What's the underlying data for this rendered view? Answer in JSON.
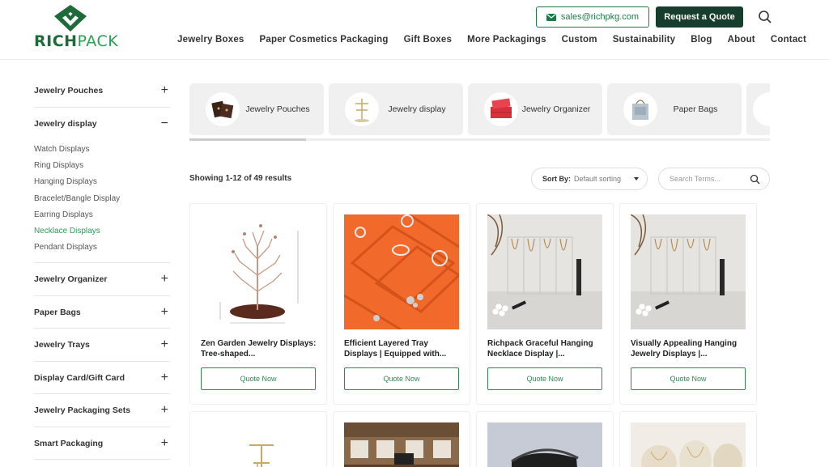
{
  "header": {
    "logo_text_bold": "RICH",
    "logo_text_light": "PACK",
    "email": "sales@richpkg.com",
    "quote_button": "Request a Quote",
    "nav": [
      "Jewelry Boxes",
      "Paper Cosmetics Packaging",
      "Gift Boxes",
      "More Packagings",
      "Custom",
      "Sustainability",
      "Blog",
      "About",
      "Contact"
    ]
  },
  "sidebar": {
    "categories": [
      {
        "label": "Jewelry Pouches",
        "sign": "+"
      },
      {
        "label": "Jewelry display",
        "sign": "−",
        "open": true,
        "subs": [
          "Watch Displays",
          "Ring Displays",
          "Hanging Displays",
          "Bracelet/Bangle Display",
          "Earring Displays",
          "Necklace Displays",
          "Pendant Displays"
        ],
        "active_sub": "Necklace Displays"
      },
      {
        "label": "Jewelry Organizer",
        "sign": "+"
      },
      {
        "label": "Paper Bags",
        "sign": "+"
      },
      {
        "label": "Jewelry Trays",
        "sign": "+"
      },
      {
        "label": "Display Card/Gift Card",
        "sign": "+"
      },
      {
        "label": "Jewelry Packaging Sets",
        "sign": "+"
      },
      {
        "label": "Smart Packaging",
        "sign": "+"
      }
    ]
  },
  "carousel": [
    "Jewelry Pouches",
    "Jewelry display",
    "Jewelry Organizer",
    "Paper Bags"
  ],
  "toolbar": {
    "results": "Showing 1-12 of 49 results",
    "sort_label": "Sort By:",
    "sort_value": "Default sorting",
    "search_placeholder": "Search Terms..."
  },
  "products": [
    {
      "title": "Zen Garden Jewelry Displays: Tree-shaped...",
      "button": "Quote Now"
    },
    {
      "title": "Efficient Layered Tray Displays | Equipped with...",
      "button": "Quote Now"
    },
    {
      "title": "Richpack Graceful Hanging Necklace Display |...",
      "button": "Quote Now"
    },
    {
      "title": "Visually Appealing Hanging Jewelry Displays |...",
      "button": "Quote Now"
    }
  ],
  "colors": {
    "brand_green": "#1e7a44",
    "dark_green": "#173d2e",
    "active_link": "#2e9a55",
    "tray_orange": "#f26a2b"
  }
}
